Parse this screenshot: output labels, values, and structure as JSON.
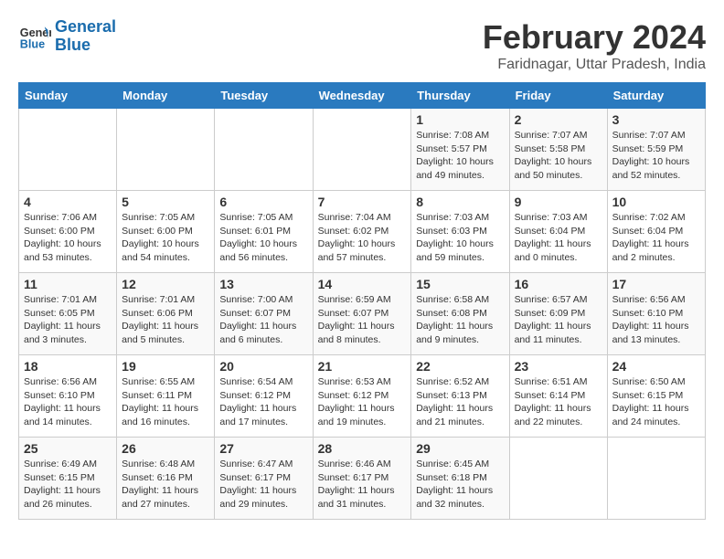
{
  "logo": {
    "text_general": "General",
    "text_blue": "Blue"
  },
  "title": "February 2024",
  "subtitle": "Faridnagar, Uttar Pradesh, India",
  "days_of_week": [
    "Sunday",
    "Monday",
    "Tuesday",
    "Wednesday",
    "Thursday",
    "Friday",
    "Saturday"
  ],
  "weeks": [
    [
      {
        "day": "",
        "info": ""
      },
      {
        "day": "",
        "info": ""
      },
      {
        "day": "",
        "info": ""
      },
      {
        "day": "",
        "info": ""
      },
      {
        "day": "1",
        "info": "Sunrise: 7:08 AM\nSunset: 5:57 PM\nDaylight: 10 hours\nand 49 minutes."
      },
      {
        "day": "2",
        "info": "Sunrise: 7:07 AM\nSunset: 5:58 PM\nDaylight: 10 hours\nand 50 minutes."
      },
      {
        "day": "3",
        "info": "Sunrise: 7:07 AM\nSunset: 5:59 PM\nDaylight: 10 hours\nand 52 minutes."
      }
    ],
    [
      {
        "day": "4",
        "info": "Sunrise: 7:06 AM\nSunset: 6:00 PM\nDaylight: 10 hours\nand 53 minutes."
      },
      {
        "day": "5",
        "info": "Sunrise: 7:05 AM\nSunset: 6:00 PM\nDaylight: 10 hours\nand 54 minutes."
      },
      {
        "day": "6",
        "info": "Sunrise: 7:05 AM\nSunset: 6:01 PM\nDaylight: 10 hours\nand 56 minutes."
      },
      {
        "day": "7",
        "info": "Sunrise: 7:04 AM\nSunset: 6:02 PM\nDaylight: 10 hours\nand 57 minutes."
      },
      {
        "day": "8",
        "info": "Sunrise: 7:03 AM\nSunset: 6:03 PM\nDaylight: 10 hours\nand 59 minutes."
      },
      {
        "day": "9",
        "info": "Sunrise: 7:03 AM\nSunset: 6:04 PM\nDaylight: 11 hours\nand 0 minutes."
      },
      {
        "day": "10",
        "info": "Sunrise: 7:02 AM\nSunset: 6:04 PM\nDaylight: 11 hours\nand 2 minutes."
      }
    ],
    [
      {
        "day": "11",
        "info": "Sunrise: 7:01 AM\nSunset: 6:05 PM\nDaylight: 11 hours\nand 3 minutes."
      },
      {
        "day": "12",
        "info": "Sunrise: 7:01 AM\nSunset: 6:06 PM\nDaylight: 11 hours\nand 5 minutes."
      },
      {
        "day": "13",
        "info": "Sunrise: 7:00 AM\nSunset: 6:07 PM\nDaylight: 11 hours\nand 6 minutes."
      },
      {
        "day": "14",
        "info": "Sunrise: 6:59 AM\nSunset: 6:07 PM\nDaylight: 11 hours\nand 8 minutes."
      },
      {
        "day": "15",
        "info": "Sunrise: 6:58 AM\nSunset: 6:08 PM\nDaylight: 11 hours\nand 9 minutes."
      },
      {
        "day": "16",
        "info": "Sunrise: 6:57 AM\nSunset: 6:09 PM\nDaylight: 11 hours\nand 11 minutes."
      },
      {
        "day": "17",
        "info": "Sunrise: 6:56 AM\nSunset: 6:10 PM\nDaylight: 11 hours\nand 13 minutes."
      }
    ],
    [
      {
        "day": "18",
        "info": "Sunrise: 6:56 AM\nSunset: 6:10 PM\nDaylight: 11 hours\nand 14 minutes."
      },
      {
        "day": "19",
        "info": "Sunrise: 6:55 AM\nSunset: 6:11 PM\nDaylight: 11 hours\nand 16 minutes."
      },
      {
        "day": "20",
        "info": "Sunrise: 6:54 AM\nSunset: 6:12 PM\nDaylight: 11 hours\nand 17 minutes."
      },
      {
        "day": "21",
        "info": "Sunrise: 6:53 AM\nSunset: 6:12 PM\nDaylight: 11 hours\nand 19 minutes."
      },
      {
        "day": "22",
        "info": "Sunrise: 6:52 AM\nSunset: 6:13 PM\nDaylight: 11 hours\nand 21 minutes."
      },
      {
        "day": "23",
        "info": "Sunrise: 6:51 AM\nSunset: 6:14 PM\nDaylight: 11 hours\nand 22 minutes."
      },
      {
        "day": "24",
        "info": "Sunrise: 6:50 AM\nSunset: 6:15 PM\nDaylight: 11 hours\nand 24 minutes."
      }
    ],
    [
      {
        "day": "25",
        "info": "Sunrise: 6:49 AM\nSunset: 6:15 PM\nDaylight: 11 hours\nand 26 minutes."
      },
      {
        "day": "26",
        "info": "Sunrise: 6:48 AM\nSunset: 6:16 PM\nDaylight: 11 hours\nand 27 minutes."
      },
      {
        "day": "27",
        "info": "Sunrise: 6:47 AM\nSunset: 6:17 PM\nDaylight: 11 hours\nand 29 minutes."
      },
      {
        "day": "28",
        "info": "Sunrise: 6:46 AM\nSunset: 6:17 PM\nDaylight: 11 hours\nand 31 minutes."
      },
      {
        "day": "29",
        "info": "Sunrise: 6:45 AM\nSunset: 6:18 PM\nDaylight: 11 hours\nand 32 minutes."
      },
      {
        "day": "",
        "info": ""
      },
      {
        "day": "",
        "info": ""
      }
    ]
  ]
}
